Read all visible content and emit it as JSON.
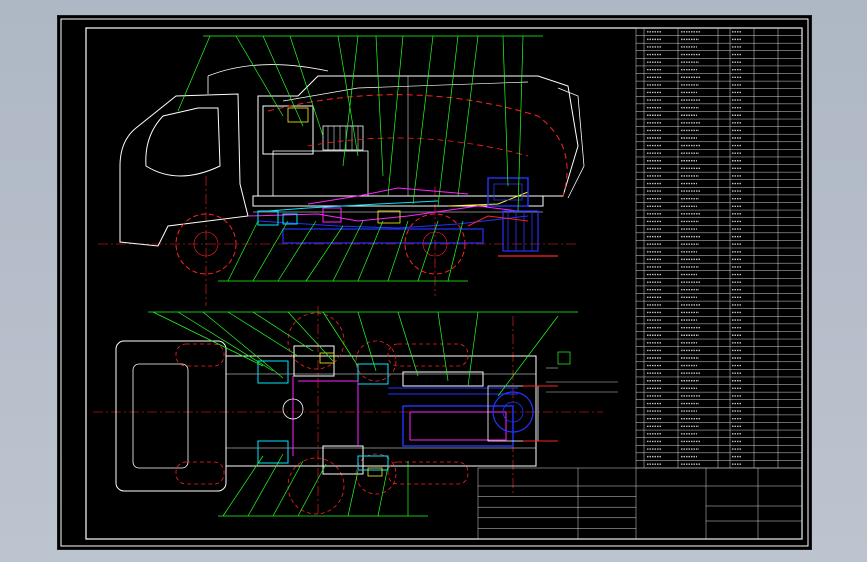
{
  "window": {
    "title": ""
  },
  "drawing": {
    "background": "#000000",
    "colors": {
      "frame": "#ffffff",
      "leader": "#22ff22",
      "centerline": "#ff2222",
      "hidden": "#ff2222",
      "body": "#ffffff",
      "mechanism_blue": "#2233ff",
      "mechanism_cyan": "#00e5ff",
      "mechanism_magenta": "#ff22ff",
      "mechanism_yellow": "#ffee22",
      "table_text": "#e8e8e8"
    },
    "parts_list_rows": 58,
    "notes_visible": true
  },
  "icons": {
    "workspace": "cad-model-space"
  }
}
